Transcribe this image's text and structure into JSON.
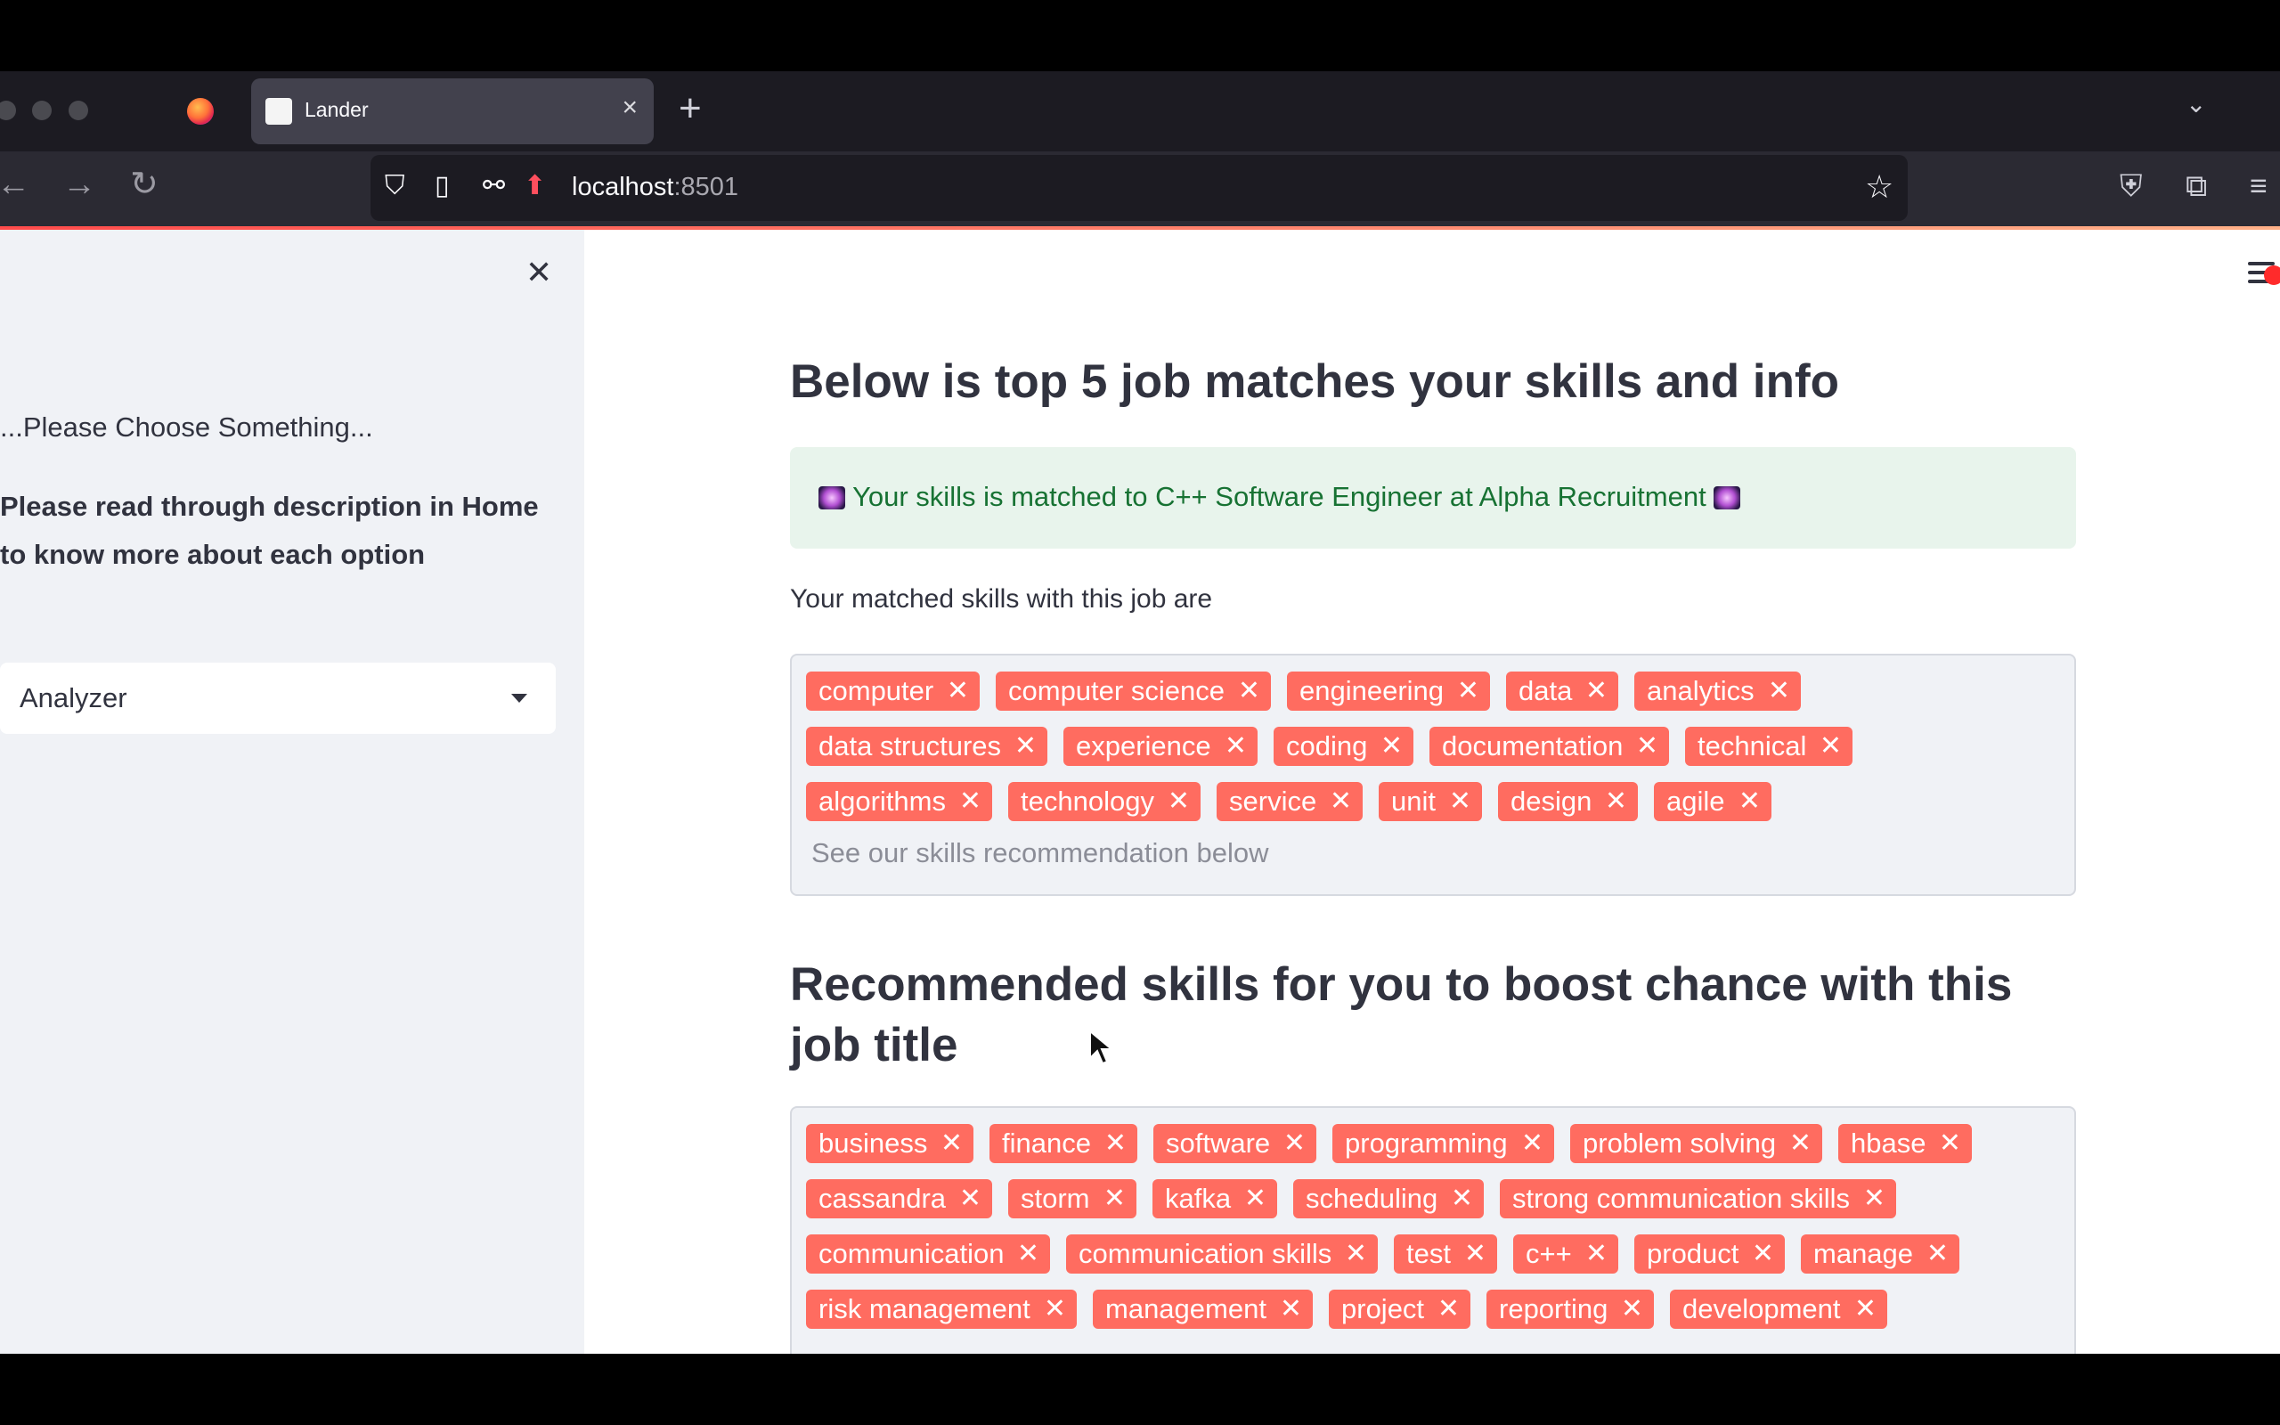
{
  "browser": {
    "tab_title": "Lander",
    "url_host": "localhost",
    "url_port": ":8501"
  },
  "sidebar": {
    "prompt": "...Please Choose Something...",
    "note": "Please read through description in Home to know more about each option",
    "select_value": "Analyzer"
  },
  "main": {
    "heading": "Below is top 5 job matches your skills and info",
    "success_message": "Your skills is matched to C++ Software Engineer at Alpha Recruitment",
    "matched_label": "Your matched skills with this job are",
    "matched_skills": [
      [
        "computer",
        "computer science",
        "engineering",
        "data",
        "analytics"
      ],
      [
        "data structures",
        "experience",
        "coding",
        "documentation",
        "technical"
      ],
      [
        "algorithms",
        "technology",
        "service",
        "unit",
        "design",
        "agile"
      ]
    ],
    "matched_placeholder": "See our skills recommendation below",
    "recommend_heading": "Recommended skills for you to boost chance with this job title",
    "recommended_skills": [
      [
        "business",
        "finance",
        "software",
        "programming",
        "problem solving",
        "hbase"
      ],
      [
        "cassandra",
        "storm",
        "kafka",
        "scheduling",
        "strong communication skills"
      ],
      [
        "communication",
        "communication skills",
        "test",
        "c++",
        "product",
        "manage"
      ],
      [
        "risk management",
        "management",
        "project",
        "reporting",
        "development"
      ]
    ]
  },
  "colors": {
    "tag": "#ff6c60",
    "success_bg": "#e8f4ec",
    "success_text": "#177233"
  }
}
